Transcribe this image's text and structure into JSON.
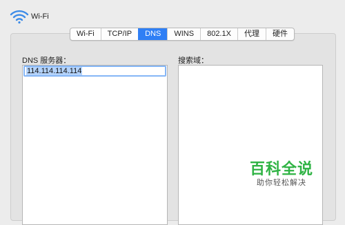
{
  "window": {
    "title": "Wi-Fi",
    "icon": "wifi-icon"
  },
  "tabs": [
    {
      "label": "Wi-Fi",
      "active": false
    },
    {
      "label": "TCP/IP",
      "active": false
    },
    {
      "label": "DNS",
      "active": true
    },
    {
      "label": "WINS",
      "active": false
    },
    {
      "label": "802.1X",
      "active": false
    },
    {
      "label": "代理",
      "active": false
    },
    {
      "label": "硬件",
      "active": false
    }
  ],
  "dns": {
    "label": "DNS 服务器：",
    "servers": [
      "114.114.114.114"
    ]
  },
  "search_domains": {
    "label": "搜索域：",
    "items": []
  },
  "watermark": {
    "title": "百科全说",
    "subtitle": "助你轻松解决"
  },
  "colors": {
    "accent": "#2f7ff5",
    "watermark": "#2fb344"
  }
}
